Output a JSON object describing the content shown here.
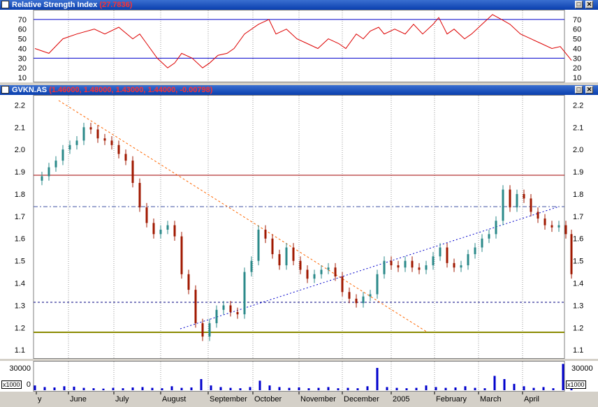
{
  "rsi_panel": {
    "title": "Relative Strength Index",
    "value": "(27.7836)",
    "y_ticks": [
      "70",
      "60",
      "50",
      "40",
      "30",
      "20",
      "10"
    ],
    "levels": [
      70,
      30
    ],
    "ylim": [
      5,
      80
    ]
  },
  "price_panel": {
    "title": "GVKN.AS",
    "ohlc": "(1.46000, 1.48000, 1.43000, 1.44000, -0.00798)",
    "y_ticks": [
      "2.2",
      "2.1",
      "2.0",
      "1.9",
      "1.8",
      "1.7",
      "1.6",
      "1.5",
      "1.4",
      "1.3",
      "1.2",
      "1.1"
    ],
    "ylim": [
      1.06,
      2.245
    ]
  },
  "volume_panel": {
    "tick": "30000",
    "zero": "0",
    "multiplier": "x1000"
  },
  "x_axis": {
    "labels": [
      "y",
      "June",
      "July",
      "August",
      "September",
      "October",
      "November",
      "December",
      "2005",
      "February",
      "March",
      "April"
    ]
  },
  "buttons": {
    "restore": "□",
    "close": "✕"
  },
  "colors": {
    "title_bar": "#0a3fae",
    "rsi_line": "#dd0000",
    "rsi_levels": "#0000cc",
    "candle_up": "#2b8a8a",
    "candle_down": "#a01800",
    "resistance": "#a00000",
    "support": "#8a8a00",
    "downtrend": "#ff6600",
    "uptrend": "#0000cc",
    "volume": "#0000cc"
  },
  "chart_data": [
    {
      "type": "line",
      "name": "rsi",
      "x_index": [
        0,
        20,
        40,
        60,
        85,
        100,
        120,
        140,
        150,
        160,
        175,
        190,
        200,
        210,
        225,
        240,
        250,
        262,
        275,
        285,
        300,
        320,
        335,
        345,
        360,
        375,
        390,
        405,
        420,
        435,
        445,
        460,
        470,
        480,
        492,
        500,
        515,
        530,
        542,
        555,
        570,
        578,
        590,
        600,
        615,
        625,
        640,
        655,
        668,
        680,
        695,
        710,
        725,
        740,
        752,
        760,
        768
      ],
      "values": [
        40,
        35,
        50,
        55,
        60,
        55,
        62,
        50,
        55,
        45,
        30,
        20,
        25,
        35,
        30,
        20,
        25,
        33,
        35,
        40,
        55,
        65,
        70,
        55,
        60,
        50,
        45,
        40,
        50,
        45,
        40,
        55,
        50,
        58,
        62,
        55,
        60,
        55,
        65,
        55,
        65,
        72,
        55,
        60,
        50,
        55,
        65,
        75,
        70,
        65,
        55,
        50,
        45,
        40,
        42,
        35,
        27.8
      ]
    },
    {
      "type": "candlestick",
      "name": "GVKN.AS",
      "x_index": [
        0,
        10,
        20,
        30,
        40,
        50,
        60,
        70,
        80,
        90,
        100,
        110,
        120,
        130,
        140,
        150,
        160,
        170,
        180,
        190,
        200,
        210,
        220,
        230,
        240,
        250,
        260,
        270,
        280,
        290,
        300,
        310,
        320,
        330,
        340,
        350,
        360,
        370,
        380,
        390,
        400,
        410,
        420,
        430,
        440,
        450,
        460,
        470,
        480,
        490,
        500,
        510,
        520,
        530,
        540,
        550,
        560,
        570,
        580,
        590,
        600,
        610,
        620,
        630,
        640,
        650,
        660,
        670,
        680,
        690,
        700,
        710,
        720,
        730,
        740,
        750,
        760,
        768
      ],
      "close": [
        1.86,
        1.88,
        1.92,
        1.95,
        2.0,
        2.02,
        2.04,
        2.1,
        2.09,
        2.05,
        2.04,
        2.02,
        1.98,
        1.95,
        1.85,
        1.74,
        1.67,
        1.62,
        1.64,
        1.66,
        1.61,
        1.44,
        1.37,
        1.22,
        1.16,
        1.22,
        1.28,
        1.3,
        1.27,
        1.26,
        1.45,
        1.5,
        1.64,
        1.6,
        1.53,
        1.48,
        1.56,
        1.5,
        1.46,
        1.42,
        1.44,
        1.46,
        1.47,
        1.43,
        1.36,
        1.33,
        1.31,
        1.34,
        1.35,
        1.44,
        1.5,
        1.48,
        1.47,
        1.5,
        1.47,
        1.46,
        1.48,
        1.52,
        1.56,
        1.49,
        1.47,
        1.48,
        1.53,
        1.56,
        1.6,
        1.62,
        1.68,
        1.82,
        1.74,
        1.8,
        1.78,
        1.72,
        1.69,
        1.66,
        1.65,
        1.66,
        1.62,
        1.44
      ]
    },
    {
      "type": "bar",
      "name": "volume",
      "ylim": [
        0,
        35000
      ],
      "x_index": [
        0,
        14,
        28,
        42,
        56,
        70,
        84,
        98,
        112,
        126,
        140,
        154,
        168,
        182,
        196,
        210,
        224,
        238,
        252,
        266,
        280,
        294,
        308,
        322,
        336,
        350,
        364,
        378,
        392,
        406,
        420,
        434,
        448,
        462,
        476,
        490,
        504,
        518,
        532,
        546,
        560,
        574,
        588,
        602,
        616,
        630,
        644,
        658,
        672,
        686,
        700,
        714,
        728,
        742,
        756,
        768
      ],
      "values": [
        6000,
        4000,
        3500,
        5000,
        4500,
        3000,
        2500,
        2000,
        3000,
        2500,
        3500,
        4000,
        3000,
        2500,
        5000,
        3000,
        3500,
        14000,
        6000,
        4000,
        3000,
        2500,
        4000,
        12000,
        6000,
        4000,
        3000,
        3500,
        2500,
        3000,
        4000,
        2500,
        3000,
        2500,
        5000,
        28000,
        4000,
        3000,
        2500,
        3000,
        6000,
        4000,
        3000,
        3500,
        5000,
        3000,
        2500,
        18000,
        14000,
        8000,
        5000,
        3000,
        4000,
        2500,
        33000,
        12000
      ]
    }
  ]
}
